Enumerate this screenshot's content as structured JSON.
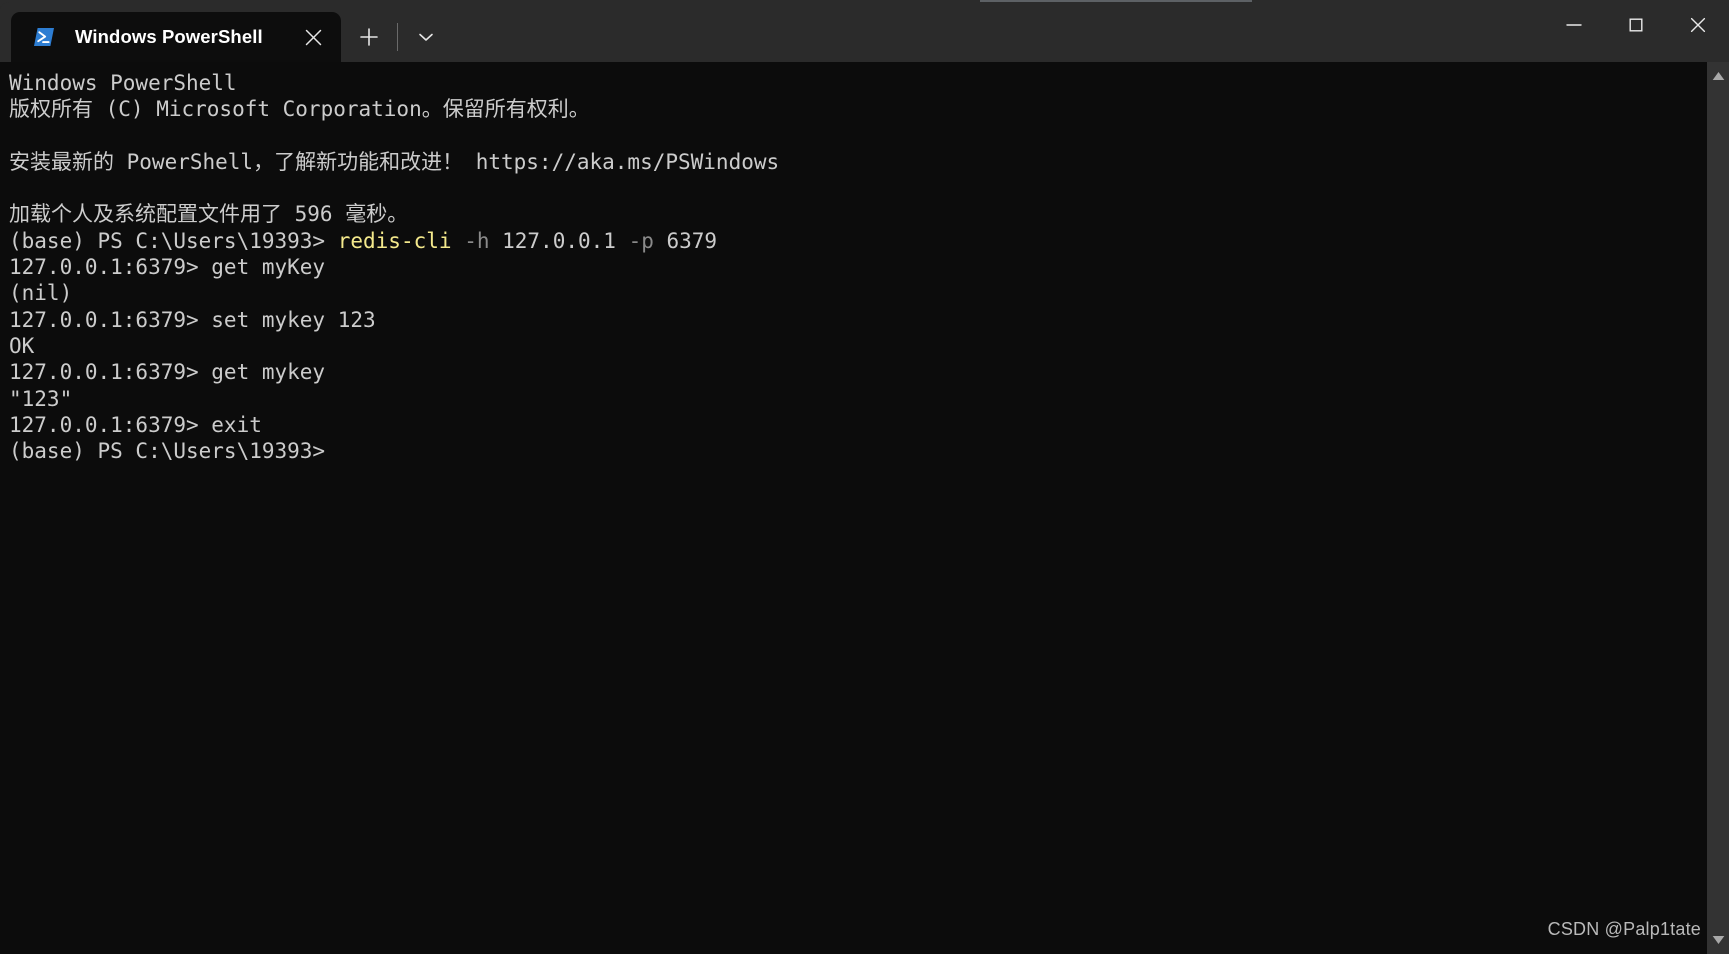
{
  "window": {
    "title": "Windows PowerShell",
    "app_icon": "powershell-icon",
    "accent_color": "#2d7dd2",
    "titlebar_bg": "#2b2b2b",
    "tab_bg": "#0d0d0d",
    "console_bg": "#0c0c0c",
    "console_fg": "#cccccc"
  },
  "tab": {
    "label": "Windows PowerShell",
    "close_label": "✕"
  },
  "tabstrip": {
    "new_tab_label": "+",
    "dropdown_label": "⌄"
  },
  "caption": {
    "minimize_label": "–",
    "maximize_label": "□",
    "close_label": "✕"
  },
  "scrollbar": {
    "up_arrow": "▲",
    "down_arrow": "▼"
  },
  "console": {
    "lines": [
      {
        "id": "banner-title",
        "segments": [
          {
            "text": "Windows PowerShell",
            "color": "default"
          }
        ]
      },
      {
        "id": "banner-copyright",
        "segments": [
          {
            "text": "版权所有 (C) Microsoft Corporation。保留所有权利。",
            "color": "default"
          }
        ]
      },
      {
        "id": "blank-1",
        "segments": [
          {
            "text": "",
            "color": "default"
          }
        ]
      },
      {
        "id": "banner-upgrade",
        "segments": [
          {
            "text": "安装最新的 PowerShell，了解新功能和改进！ https://aka.ms/PSWindows",
            "color": "default"
          }
        ]
      },
      {
        "id": "blank-2",
        "segments": [
          {
            "text": "",
            "color": "default"
          }
        ]
      },
      {
        "id": "profile-load",
        "segments": [
          {
            "text": "加载个人及系统配置文件用了 596 毫秒。",
            "color": "default"
          }
        ]
      },
      {
        "id": "cmd-redis-cli",
        "segments": [
          {
            "text": "(base) PS C:\\Users\\19393> ",
            "color": "default"
          },
          {
            "text": "redis-cli",
            "color": "yellow"
          },
          {
            "text": " ",
            "color": "default"
          },
          {
            "text": "-h",
            "color": "dim"
          },
          {
            "text": " 127.0.0.1 ",
            "color": "default"
          },
          {
            "text": "-p",
            "color": "dim"
          },
          {
            "text": " 6379",
            "color": "default"
          }
        ]
      },
      {
        "id": "cmd-get-myKey",
        "segments": [
          {
            "text": "127.0.0.1:6379> get myKey",
            "color": "default"
          }
        ]
      },
      {
        "id": "out-nil",
        "segments": [
          {
            "text": "(nil)",
            "color": "default"
          }
        ]
      },
      {
        "id": "cmd-set-mykey",
        "segments": [
          {
            "text": "127.0.0.1:6379> set mykey 123",
            "color": "default"
          }
        ]
      },
      {
        "id": "out-ok",
        "segments": [
          {
            "text": "OK",
            "color": "default"
          }
        ]
      },
      {
        "id": "cmd-get-mykey",
        "segments": [
          {
            "text": "127.0.0.1:6379> get mykey",
            "color": "default"
          }
        ]
      },
      {
        "id": "out-123",
        "segments": [
          {
            "text": "\"123\"",
            "color": "default"
          }
        ]
      },
      {
        "id": "cmd-exit",
        "segments": [
          {
            "text": "127.0.0.1:6379> exit",
            "color": "default"
          }
        ]
      },
      {
        "id": "prompt-final",
        "segments": [
          {
            "text": "(base) PS C:\\Users\\19393>",
            "color": "default"
          }
        ]
      }
    ]
  },
  "watermark": {
    "text": "CSDN @Palp1tate"
  }
}
